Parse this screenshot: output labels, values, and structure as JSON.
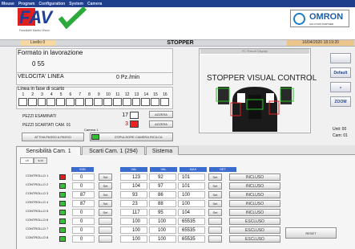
{
  "menu": [
    "Mouse",
    "Program",
    "Configuration",
    "System",
    "Camera"
  ],
  "logos": {
    "left_text": "FAV",
    "left_subtitle": "Faustinelli Marino Vision",
    "right_brand": "OMRON",
    "right_sub": "SOLUTION PARTNER"
  },
  "status": {
    "user": "Livello 0",
    "title": "STOPPER",
    "datetime": "16/04/2020 18:19:20"
  },
  "formato": {
    "title": "Formato in lavorazione",
    "value": "0 55",
    "velocita_label": "VELOCITA' LINEA",
    "velocita_value": "0 Pz./min"
  },
  "scarto": {
    "title": "Linea in fase di scarto",
    "numbers": [
      "1",
      "2",
      "3",
      "4",
      "5",
      "6",
      "7",
      "8",
      "9",
      "10",
      "11",
      "12",
      "13",
      "14",
      "15",
      "16"
    ]
  },
  "counters": {
    "esaminati_label": "PEZZI ESAMINATI",
    "esaminati_value": "17",
    "scartati_label": "PEZZI SCARTATI CAM. 01",
    "scartati_value": "3",
    "camera_label": "Camera 1",
    "azzera1": "AZZERA",
    "azzera2": "AZZERA",
    "attiva": "ATTIVA PASSO A PASSO",
    "espulsore": "ESPULSORE CAMERA RICILCA"
  },
  "camera_view": {
    "header": "FC Result Display",
    "title": "STOPPER VISUAL CONTROL"
  },
  "side_buttons": {
    "default": "Default",
    "minus": "-",
    "zoom": "ZOOM",
    "unit_label": "Unit: 00",
    "cam_label": "Cam:  01"
  },
  "tabs": {
    "tab1": "Sensibilità Cam. 1",
    "tab2": "Scarti Cam. 1 (294)",
    "tab3": "Sistema"
  },
  "subtabs": [
    "1-8",
    "9-16"
  ],
  "grid_headers": [
    "MIN",
    "VAL",
    "VAL",
    "MAX",
    "SET"
  ],
  "rows": [
    {
      "name": "CONTROLLO 1",
      "led": "#d92020",
      "v1": "0",
      "set1": "Set",
      "v2": "123",
      "v3": "92",
      "v4": "101",
      "set2": "Set",
      "state": "INCLUSO"
    },
    {
      "name": "CONTROLLO 2",
      "led": "#35c035",
      "v1": "0",
      "set1": "Set",
      "v2": "104",
      "v3": "97",
      "v4": "101",
      "set2": "Set",
      "state": "INCLUSO"
    },
    {
      "name": "CONTROLLO 3",
      "led": "#35c035",
      "v1": "87",
      "set1": "Set",
      "v2": "93",
      "v3": "86",
      "v4": "100",
      "set2": "Set",
      "state": "INCLUSO"
    },
    {
      "name": "CONTROLLO 4",
      "led": "#35c035",
      "v1": "87",
      "set1": "Set",
      "v2": "23",
      "v3": "88",
      "v4": "100",
      "set2": "Set",
      "state": "INCLUSO"
    },
    {
      "name": "CONTROLLO 5",
      "led": "#35c035",
      "v1": "0",
      "set1": "Set",
      "v2": "117",
      "v3": "95",
      "v4": "104",
      "set2": "Set",
      "state": "INCLUSO"
    },
    {
      "name": "CONTROLLO 6",
      "led": "#35c035",
      "v1": "0",
      "set1": "",
      "v2": "100",
      "v3": "100",
      "v4": "65535",
      "set2": "",
      "state": "ESCLUSO"
    },
    {
      "name": "CONTROLLO 7",
      "led": "#35c035",
      "v1": "0",
      "set1": "",
      "v2": "100",
      "v3": "100",
      "v4": "65535",
      "set2": "",
      "state": "ESCLUSO"
    },
    {
      "name": "CONTROLLO 8",
      "led": "#35c035",
      "v1": "0",
      "set1": "",
      "v2": "100",
      "v3": "100",
      "v4": "65535",
      "set2": "",
      "state": "ESCLUSO"
    }
  ],
  "reset_label": "RESET"
}
